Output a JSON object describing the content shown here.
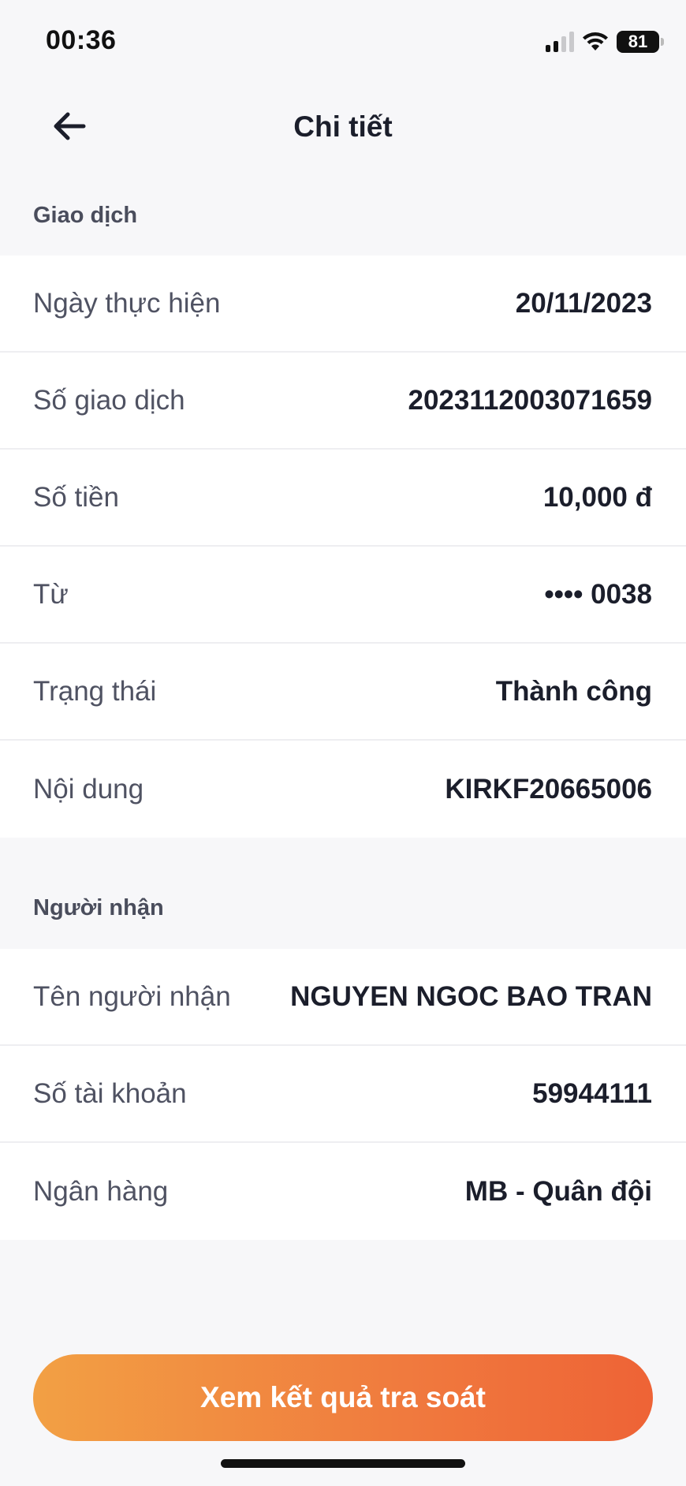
{
  "status_bar": {
    "time": "00:36",
    "battery": "81"
  },
  "header": {
    "title": "Chi tiết"
  },
  "transaction_section": {
    "title": "Giao dịch",
    "rows": [
      {
        "label": "Ngày thực hiện",
        "value": "20/11/2023"
      },
      {
        "label": "Số giao dịch",
        "value": "2023112003071659"
      },
      {
        "label": "Số tiền",
        "value": "10,000 đ"
      },
      {
        "label": "Từ",
        "value": "•••• 0038"
      },
      {
        "label": "Trạng thái",
        "value": "Thành công"
      },
      {
        "label": "Nội dung",
        "value": "KIRKF20665006"
      }
    ]
  },
  "recipient_section": {
    "title": "Người nhận",
    "rows": [
      {
        "label": "Tên người nhận",
        "value": "NGUYEN NGOC BAO TRAN"
      },
      {
        "label": "Số tài khoản",
        "value": "59944111"
      },
      {
        "label": "Ngân hàng",
        "value": "MB - Quân đội"
      }
    ]
  },
  "footer": {
    "button_label": "Xem kết quả tra soát"
  },
  "colors": {
    "accent_start": "#f2a044",
    "accent_end": "#ee6336",
    "background": "#f7f7f9"
  }
}
